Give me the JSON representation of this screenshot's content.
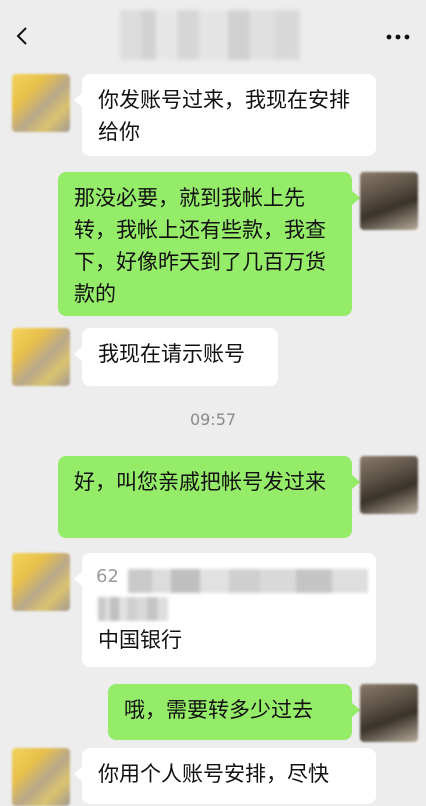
{
  "header": {
    "back_icon": "chevron-left-icon",
    "more_icon": "ellipsis-icon"
  },
  "messages": [
    {
      "side": "in",
      "text": "你发账号过来，我现在安排给你"
    },
    {
      "side": "out",
      "text": "那没必要，就到我帐上先转，我帐上还有些款，我查下，好像昨天到了几百万货款的"
    },
    {
      "side": "in",
      "text": "我现在请示账号"
    },
    {
      "side": "out",
      "text": "好，叫您亲戚把帐号发过来"
    },
    {
      "side": "in",
      "text": "中国银行",
      "prefix_visible": "62"
    },
    {
      "side": "out",
      "text": "哦，需要转多少过去"
    },
    {
      "side": "in",
      "text": "你用个人账号安排，尽快"
    }
  ],
  "timestamp": "09:57",
  "colors": {
    "background": "#ededed",
    "bubble_in": "#ffffff",
    "bubble_out": "#95ec69",
    "text": "#111111",
    "timestamp": "#8a8a8a"
  }
}
